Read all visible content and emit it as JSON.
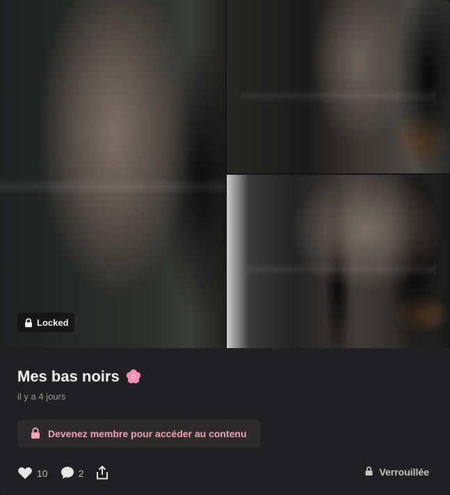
{
  "post": {
    "title": "Mes bas noirs",
    "title_emoji_icon": "cherry-blossom-icon",
    "date": "il y a 4 jours",
    "locked_badge": "Locked",
    "cta_label": "Devenez membre pour accéder au contenu",
    "likes": "10",
    "comments": "2",
    "lock_status": "Verrouillée"
  },
  "colors": {
    "card_bg": "#202022",
    "cta_text": "#f2a4b7",
    "cta_bg": "#2d2a2c",
    "flower": "#f38fb0"
  }
}
